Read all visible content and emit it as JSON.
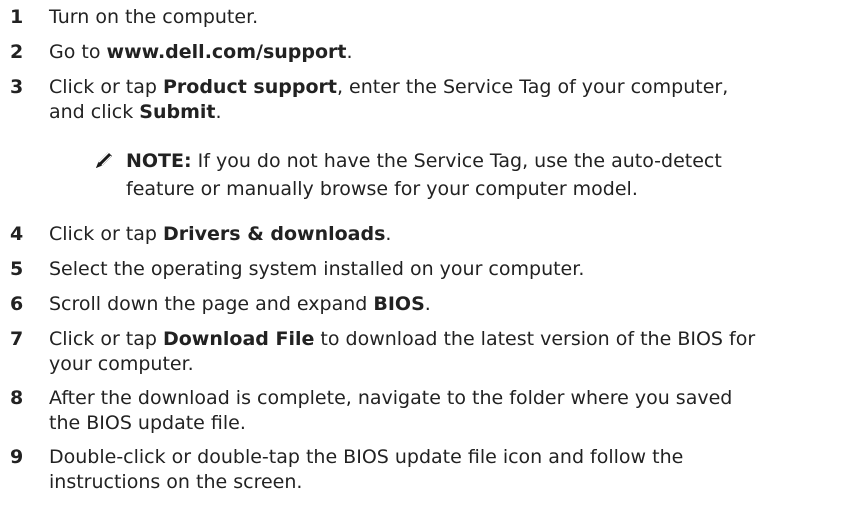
{
  "steps": [
    {
      "num": "1",
      "parts": [
        "Turn on the computer."
      ]
    },
    {
      "num": "2",
      "parts": [
        "Go to ",
        "www.dell.com/support",
        "."
      ]
    },
    {
      "num": "3",
      "line1": [
        "Click or tap ",
        "Product support",
        ", enter the Service Tag of your computer,"
      ],
      "line2": [
        "and click ",
        "Submit",
        "."
      ]
    },
    {
      "num": "4",
      "parts": [
        "Click or tap ",
        "Drivers & downloads",
        "."
      ]
    },
    {
      "num": "5",
      "parts": [
        "Select the operating system installed on your computer."
      ]
    },
    {
      "num": "6",
      "parts": [
        "Scroll down the page and expand ",
        "BIOS",
        "."
      ]
    },
    {
      "num": "7",
      "line1": [
        "Click or tap ",
        "Download File",
        " to download the latest version of the BIOS for"
      ],
      "line2": [
        "your computer."
      ]
    },
    {
      "num": "8",
      "line1": [
        "After the download is complete, navigate to the folder where you saved"
      ],
      "line2": [
        "the BIOS update file."
      ]
    },
    {
      "num": "9",
      "line1": [
        "Double-click or double-tap the BIOS update file icon and follow the"
      ],
      "line2": [
        "instructions on the screen."
      ]
    }
  ],
  "note": {
    "label": "NOTE:",
    "line1": " If you do not have the Service Tag, use the auto-detect",
    "line2": "feature or manually browse for your computer model.",
    "icon": "pencil-icon"
  }
}
